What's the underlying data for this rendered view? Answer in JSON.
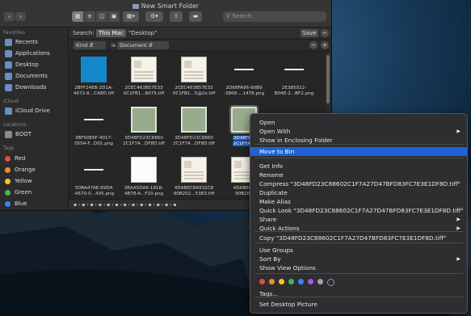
{
  "window": {
    "title": "New Smart Folder",
    "search_placeholder": "Search",
    "scope_label": "Search:",
    "scope_this_mac": "This Mac",
    "scope_desktop": "\"Desktop\"",
    "save_label": "Save",
    "filter_kind": "Kind",
    "filter_is": "is",
    "filter_document": "Document"
  },
  "sidebar": {
    "favorites_head": "Favorites",
    "favorites": [
      "Recents",
      "Applications",
      "Desktop",
      "Documents",
      "Downloads"
    ],
    "icloud_head": "iCloud",
    "icloud": [
      "iCloud Drive"
    ],
    "locations_head": "Locations",
    "locations": [
      "BOOT"
    ],
    "tags_head": "Tags",
    "tags": [
      {
        "label": "Red",
        "color": "#e5484d"
      },
      {
        "label": "Orange",
        "color": "#f28c28"
      },
      {
        "label": "Yellow",
        "color": "#f3c623"
      },
      {
        "label": "Green",
        "color": "#3fb950"
      },
      {
        "label": "Blue",
        "color": "#3b82f6"
      }
    ]
  },
  "files": [
    {
      "name1": "2BFF24EB-2D1A-",
      "name2": "4672-8...CA8D.tiff",
      "thumb": "blue"
    },
    {
      "name1": "2CEC463B57E33",
      "name2": "0C1FB1...8075.tiff",
      "thumb": "beige"
    },
    {
      "name1": "2CEC463B57E33",
      "name2": "0C1FB1...5@2x.tiff",
      "thumb": "beige"
    },
    {
      "name1": "2D68FA96-90B9",
      "name2": "-3868-...1476.png",
      "thumb": "line"
    },
    {
      "name1": "2E385022-",
      "name2": "B04E-2...BF2.png",
      "thumb": "line"
    },
    {
      "name1": "3BF50E6F-4017-",
      "name2": "0554-F...D01.png",
      "thumb": "line"
    },
    {
      "name1": "3D48FD23C8860",
      "name2": "2C1F7A...DF8D.tiff",
      "thumb": "green"
    },
    {
      "name1": "3D48FD23C8860",
      "name2": "2C1F7A...DF8D.tiff",
      "thumb": "green"
    },
    {
      "name1": "3D48FD2",
      "name2": "2C1F7A...",
      "thumb": "green",
      "selected": true
    },
    {
      "name1": "",
      "name2": "",
      "thumb": "line"
    },
    {
      "name1": "3DBA47AE-69DA",
      "name2": "-4570-0...435.png",
      "thumb": "line"
    },
    {
      "name1": "3EAA5DA6-1818-",
      "name2": "4B78-A...F10.png",
      "thumb": "white"
    },
    {
      "name1": "4DABEC8A932C8",
      "name2": "90B202...5383.tiff",
      "thumb": "beige"
    },
    {
      "name1": "4DABEC8",
      "name2": "90B202",
      "thumb": "beige"
    },
    {
      "name1": "",
      "name2": "",
      "thumb": "white"
    }
  ],
  "context_menu": {
    "items": [
      {
        "label": "Open"
      },
      {
        "label": "Open With",
        "submenu": true
      },
      {
        "label": "Show in Enclosing Folder"
      },
      {
        "label": "Move to Bin",
        "highlighted": true
      },
      {
        "label": "Get Info"
      },
      {
        "label": "Rename"
      },
      {
        "label": "Compress \"3D48FD23C88602C1F7A27D47BFD83FC7E3E1DF8D.tiff\""
      },
      {
        "label": "Duplicate"
      },
      {
        "label": "Make Alias"
      },
      {
        "label": "Quick Look \"3D48FD23C88602C1F7A27D47BFD83FC7E3E1DF8D.tiff\""
      },
      {
        "label": "Share",
        "submenu": true
      },
      {
        "label": "Quick Actions",
        "submenu": true
      },
      {
        "label": "Copy \"3D48FD23C88602C1F7A27D47BFD83FC7E3E1DF8D.tiff\""
      },
      {
        "label": "Use Groups"
      },
      {
        "label": "Sort By",
        "submenu": true
      },
      {
        "label": "Show View Options"
      },
      {
        "label": "Tags..."
      },
      {
        "label": "Set Desktop Picture"
      }
    ],
    "tag_colors": [
      "#e5484d",
      "#f28c28",
      "#f3c623",
      "#3fb950",
      "#3b82f6",
      "#a855f7",
      "#9ca3af",
      "transparent"
    ]
  },
  "icons": {
    "back": "chevron-left-icon",
    "forward": "chevron-right-icon",
    "arrow": "▶"
  }
}
